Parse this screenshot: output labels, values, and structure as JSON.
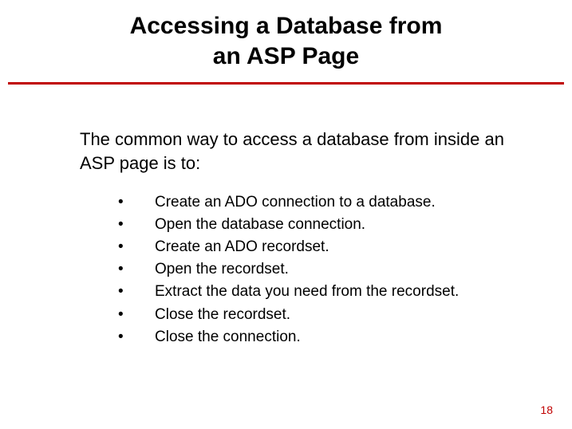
{
  "title_line1": "Accessing a Database from",
  "title_line2": "an ASP Page",
  "intro": "The common way to access a database from inside an ASP page is to:",
  "bullets": [
    "Create an ADO connection to a database.",
    "Open the database connection.",
    "Create an ADO recordset.",
    "Open the recordset.",
    "Extract the data you need from the recordset.",
    "Close the recordset.",
    "Close the connection."
  ],
  "page_number": "18"
}
